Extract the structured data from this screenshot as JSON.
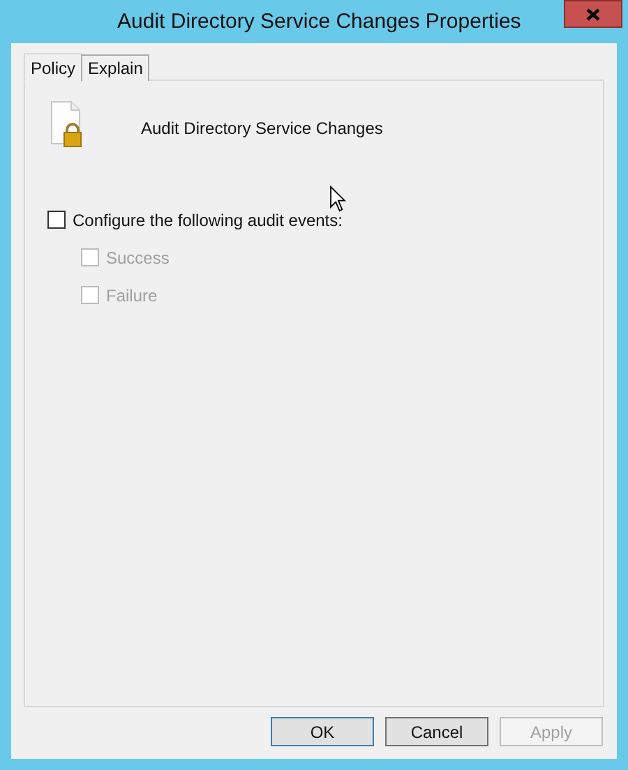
{
  "window": {
    "title": "Audit Directory Service Changes Properties"
  },
  "tabs": [
    {
      "label": "Policy",
      "selected": true
    },
    {
      "label": "Explain",
      "selected": false
    }
  ],
  "policy": {
    "name": "Audit Directory Service Changes"
  },
  "options": [
    {
      "label": "Configure the following audit events:",
      "checked": false,
      "disabled": false,
      "children": [
        {
          "label": "Success",
          "checked": false,
          "disabled": true
        },
        {
          "label": "Failure",
          "checked": false,
          "disabled": true
        }
      ]
    }
  ],
  "buttons": [
    {
      "label": "OK",
      "default": true,
      "disabled": false
    },
    {
      "label": "Cancel",
      "default": false,
      "disabled": false
    },
    {
      "label": "Apply",
      "default": false,
      "disabled": true
    }
  ]
}
